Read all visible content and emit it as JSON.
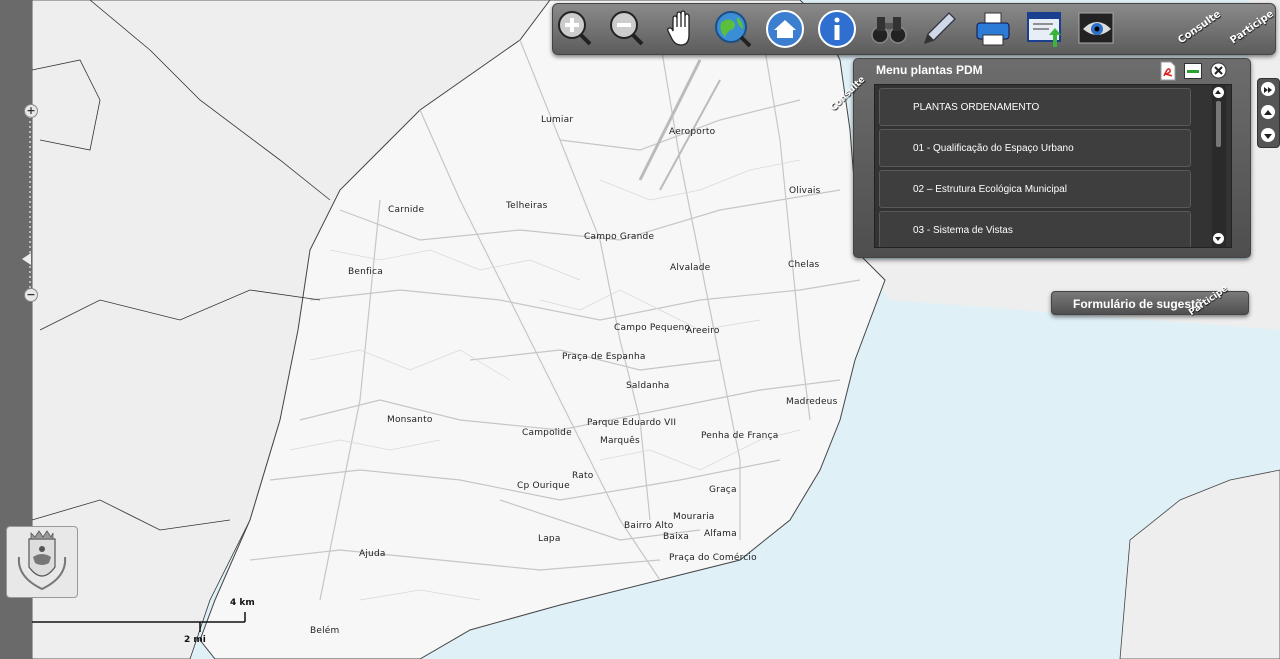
{
  "map": {
    "places": [
      {
        "name": "Lumiar"
      },
      {
        "name": "Aeroporto"
      },
      {
        "name": "Olivais"
      },
      {
        "name": "Carnide"
      },
      {
        "name": "Telheiras"
      },
      {
        "name": "Campo Grande"
      },
      {
        "name": "Benfica"
      },
      {
        "name": "Alvalade"
      },
      {
        "name": "Chelas"
      },
      {
        "name": "Campo Pequeno"
      },
      {
        "name": "Areeiro"
      },
      {
        "name": "Praça de Espanha"
      },
      {
        "name": "Saldanha"
      },
      {
        "name": "Monsanto"
      },
      {
        "name": "Madredeus"
      },
      {
        "name": "Parque Eduardo VII"
      },
      {
        "name": "Campolide"
      },
      {
        "name": "Marquês"
      },
      {
        "name": "Penha de França"
      },
      {
        "name": "Rato"
      },
      {
        "name": "Cp Ourique"
      },
      {
        "name": "Graça"
      },
      {
        "name": "Mouraria"
      },
      {
        "name": "Bairro Alto"
      },
      {
        "name": "Alfama"
      },
      {
        "name": "Lapa"
      },
      {
        "name": "Baixa"
      },
      {
        "name": "Ajuda"
      },
      {
        "name": "Praça do Comércio"
      },
      {
        "name": "Belém"
      }
    ],
    "scale": {
      "metric": "4 km",
      "imperial": "2 mi"
    },
    "colors": {
      "land": "#f7f7f7",
      "water": "#dff0f7",
      "roads": "#c6c6c6",
      "outside": "#eeeeee"
    }
  },
  "toolbar": {
    "tools": [
      {
        "icon": "zoom-in-icon"
      },
      {
        "icon": "zoom-out-icon"
      },
      {
        "icon": "pan-hand-icon"
      },
      {
        "icon": "globe-search-icon"
      },
      {
        "icon": "home-icon"
      },
      {
        "icon": "info-icon"
      },
      {
        "icon": "binoculars-icon"
      },
      {
        "icon": "pencil-icon"
      },
      {
        "icon": "printer-icon"
      },
      {
        "icon": "export-icon"
      },
      {
        "icon": "eye-icon"
      }
    ],
    "consulte": "Consulte",
    "participe": "Participe"
  },
  "panel": {
    "title": "Menu plantas PDM",
    "tab_label": "Consulte",
    "items": [
      "PLANTAS ORDENAMENTO",
      "01 - Qualificação do Espaço Urbano",
      "02 – Estrutura Ecológica Municipal",
      "03 - Sistema de Vistas"
    ]
  },
  "form_button": {
    "label": "Formulário de sugestõ",
    "tab_label": "Participe"
  }
}
